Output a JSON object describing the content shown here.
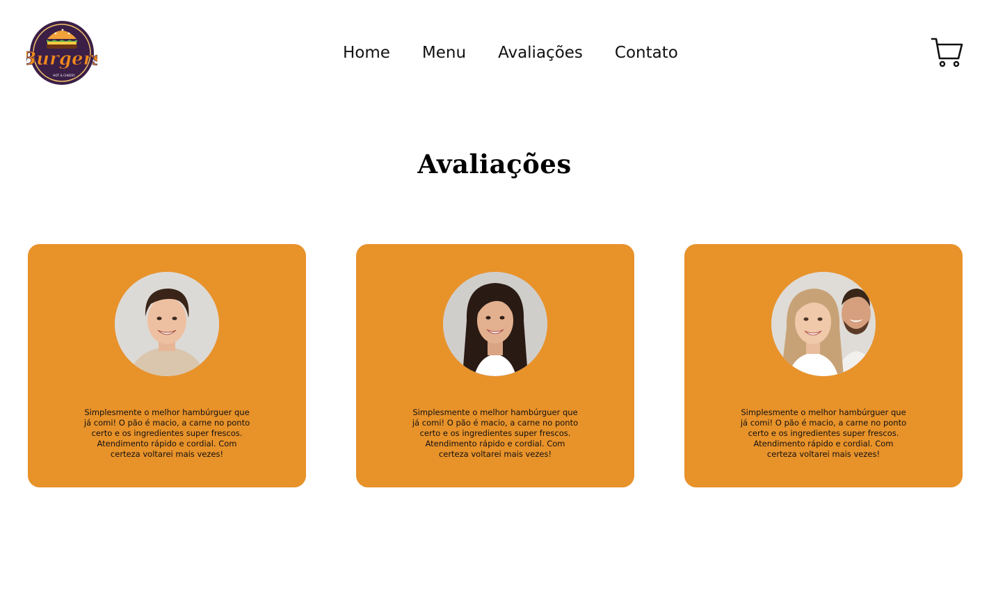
{
  "brand": {
    "logo_text": "Burgers",
    "logo_subtext": "HOT & CHEESY",
    "logo_icon": "burger-logo"
  },
  "nav": {
    "items": [
      {
        "label": "Home"
      },
      {
        "label": "Menu"
      },
      {
        "label": "Avaliações"
      },
      {
        "label": "Contato"
      }
    ],
    "cart_icon": "shopping-cart-icon"
  },
  "section": {
    "title": "Avaliações"
  },
  "reviews": [
    {
      "text": "Simplesmente o melhor hambúrguer que já comi! O pão é macio, a carne no ponto certo e os ingredientes super frescos. Atendimento rápido e cordial. Com certeza voltarei mais vezes!",
      "avatar": "young-man-photo"
    },
    {
      "text": "Simplesmente o melhor hambúrguer que já comi! O pão é macio, a carne no ponto certo e os ingredientes super frescos. Atendimento rápido e cordial. Com certeza voltarei mais vezes!",
      "avatar": "young-woman-photo"
    },
    {
      "text": "Simplesmente o melhor hambúrguer que já comi! O pão é macio, a carne no ponto certo e os ingredientes super frescos. Atendimento rápido e cordial. Com certeza voltarei mais vezes!",
      "avatar": "couple-photo"
    }
  ],
  "colors": {
    "card_background": "#e8922a",
    "logo_purple": "#3b1f47",
    "logo_orange": "#f08a1c"
  }
}
